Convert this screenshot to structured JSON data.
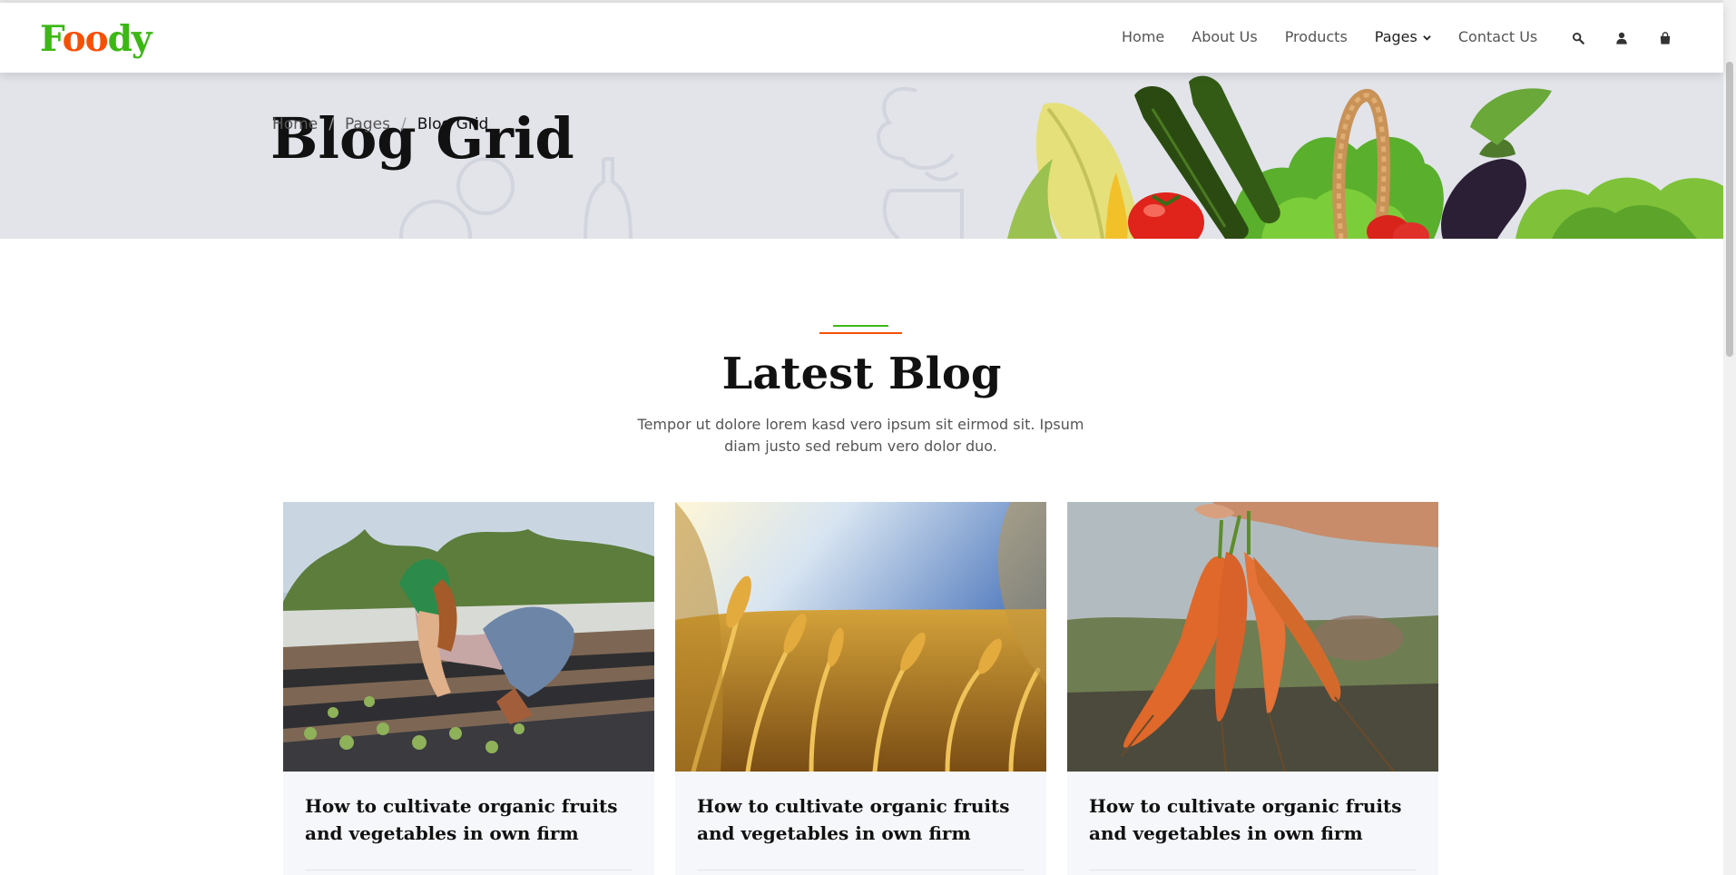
{
  "brand": {
    "logo_letters": [
      "F",
      "o",
      "o",
      "d",
      "y"
    ],
    "primary_color": "#3cb815",
    "secondary_color": "#f65005"
  },
  "nav": {
    "links": [
      "Home",
      "About Us",
      "Products",
      "Pages",
      "Contact Us"
    ],
    "icons": [
      "search-icon",
      "user-icon",
      "shopping-bag-icon"
    ]
  },
  "hero": {
    "title": "Blog Grid",
    "breadcrumb": [
      "Home",
      "Pages",
      "Blog Grid"
    ]
  },
  "section": {
    "title": "Latest Blog",
    "subtitle": "Tempor ut dolore lorem kasd vero ipsum sit eirmod sit. Ipsum diam justo sed rebum vero dolor duo."
  },
  "posts": [
    {
      "title": "How to cultivate organic fruits and vegetables in own firm",
      "image": "farmer-planting-seedlings"
    },
    {
      "title": "How to cultivate organic fruits and vegetables in own firm",
      "image": "wheat-field"
    },
    {
      "title": "How to cultivate organic fruits and vegetables in own firm",
      "image": "hand-holding-carrots"
    }
  ]
}
